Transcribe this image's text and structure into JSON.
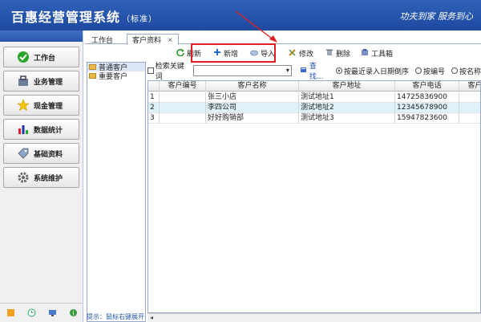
{
  "header": {
    "title": "百惠经营管理系统",
    "edition": "（标准）",
    "slogan": "功夫到家  服务到心"
  },
  "sidebar": {
    "items": [
      {
        "label": "工作台",
        "icon": "check-icon"
      },
      {
        "label": "业务管理",
        "icon": "bag-icon"
      },
      {
        "label": "现金管理",
        "icon": "star-icon"
      },
      {
        "label": "数据统计",
        "icon": "chart-icon"
      },
      {
        "label": "基础资料",
        "icon": "tag-icon"
      },
      {
        "label": "系统维护",
        "icon": "gear-icon"
      }
    ]
  },
  "tabs": {
    "workbench": "工作台",
    "customer": "客户资料",
    "close": "×"
  },
  "toolbar": {
    "refresh": "刷新",
    "new": "新增",
    "import": "导入",
    "edit": "修改",
    "delete": "删除",
    "toolbox": "工具箱"
  },
  "tree": {
    "items": [
      "普通客户",
      "重要客户"
    ]
  },
  "hint": "提示：鼠标右键展开",
  "search": {
    "checkbox_label": "检索关键词",
    "find": "查找...",
    "sort_recent": "按最近录入日期倒序",
    "sort_code": "按编号",
    "sort_name": "按名称"
  },
  "table": {
    "headers": [
      "",
      "客户编号",
      "客户名称",
      "客户地址",
      "客户电话",
      "客户"
    ],
    "rows": [
      {
        "idx": "1",
        "code": "",
        "name": "张三小店",
        "addr": "测试地址1",
        "phone": "14725836900"
      },
      {
        "idx": "2",
        "code": "",
        "name": "李四公司",
        "addr": "测试地址2",
        "phone": "12345678900"
      },
      {
        "idx": "3",
        "code": "",
        "name": "好好购销部",
        "addr": "测试地址3",
        "phone": "15947823600"
      }
    ]
  },
  "colors": {
    "header_bg": "#2f61b8",
    "highlight": "#e02020",
    "row_select": "#dff1fb"
  }
}
